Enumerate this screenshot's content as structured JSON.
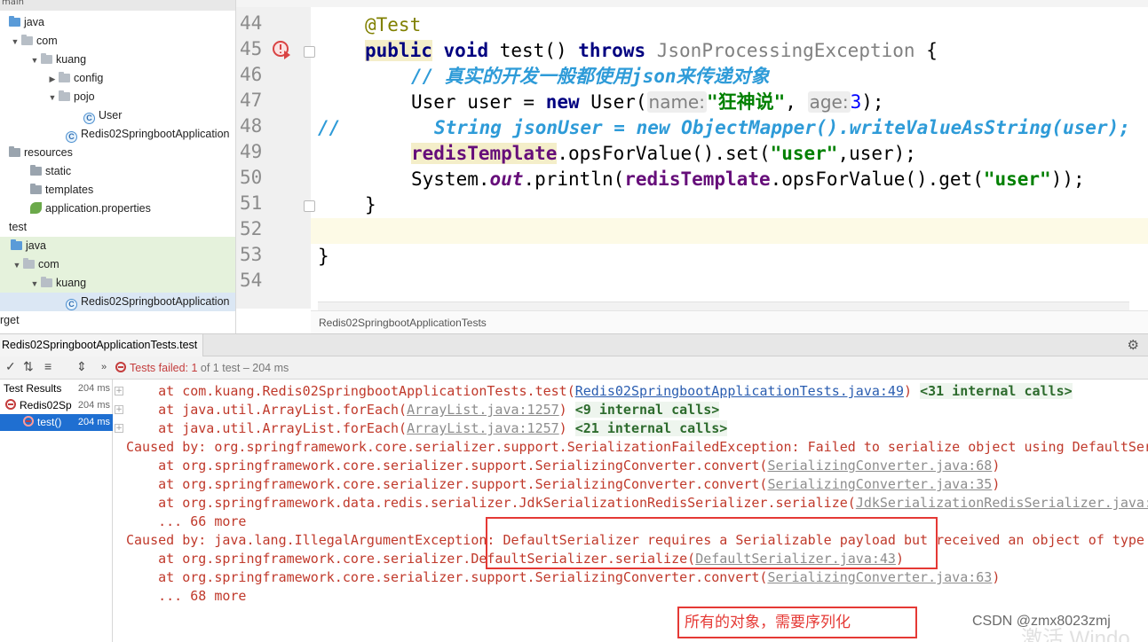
{
  "tree": {
    "top_label": "main",
    "items": [
      {
        "label": "java",
        "icon": "folder-blue-icon"
      },
      {
        "label": "com",
        "icon": "package-icon"
      },
      {
        "label": "kuang",
        "icon": "package-icon"
      },
      {
        "label": "config",
        "icon": "package-icon"
      },
      {
        "label": "pojo",
        "icon": "package-icon"
      },
      {
        "label": "User",
        "icon": "class-icon"
      },
      {
        "label": "Redis02SpringbootApplication",
        "icon": "class-icon"
      },
      {
        "label": "resources",
        "icon": "folder-icon"
      },
      {
        "label": "static",
        "icon": "folder-icon"
      },
      {
        "label": "templates",
        "icon": "folder-icon"
      },
      {
        "label": "application.properties",
        "icon": "properties-icon"
      },
      {
        "label": "test",
        "icon": ""
      },
      {
        "label": "java",
        "icon": "folder-blue-icon"
      },
      {
        "label": "com",
        "icon": "package-icon"
      },
      {
        "label": "kuang",
        "icon": "package-icon"
      },
      {
        "label": "Redis02SpringbootApplication",
        "icon": "class-icon"
      },
      {
        "label": "rget",
        "icon": ""
      }
    ]
  },
  "editor": {
    "line_numbers": [
      "44",
      "45",
      "46",
      "47",
      "48",
      "49",
      "50",
      "51",
      "52",
      "53",
      "54"
    ],
    "line44": "@Test",
    "line45": {
      "kw1": "public",
      "kw2": "void",
      "name": " test() ",
      "kw3": "throws",
      "exc": " JsonProcessingException",
      "tail": " {"
    },
    "line46": "// 真实的开发一般都使用json来传递对象",
    "line47": {
      "type": "User user = ",
      "kw": "new",
      "cls": " User(",
      "hint1": "name:",
      "str": "\"狂神说\"",
      "sep": ", ",
      "hint2": "age:",
      "num": "3",
      "tail": ");"
    },
    "line48": {
      "prefix": "//",
      "code": "String jsonUser = new ObjectMapper().writeValueAsString(user);"
    },
    "line49": {
      "field": "redisTemplate",
      "mid": ".opsForValue().set(",
      "str": "\"user\"",
      "tail": ",user);"
    },
    "line50": {
      "a": "System.",
      "b": "out",
      "c": ".println(",
      "d": "redisTemplate",
      "e": ".opsForValue().get(",
      "f": "\"user\"",
      "g": "));"
    },
    "line51": "}",
    "line53": "}",
    "breadcrumb": "Redis02SpringbootApplicationTests"
  },
  "run": {
    "tab": "Redis02SpringbootApplicationTests.test",
    "fail_label": "Tests failed: 1",
    "fail_detail": " of 1 test – 204 ms",
    "results": [
      {
        "label": "Test Results",
        "time": "204 ms"
      },
      {
        "label": "Redis02Sp",
        "time": "204 ms"
      },
      {
        "label": "test()",
        "time": "204 ms"
      }
    ]
  },
  "console": {
    "l1": {
      "pre": "    at com.kuang.Redis02SpringbootApplicationTests.test(",
      "link": "Redis02SpringbootApplicationTests.java:49",
      "post": ") ",
      "ic": "<31 internal calls>"
    },
    "l2": {
      "pre": "    at java.util.ArrayList.forEach(",
      "link": "ArrayList.java:1257",
      "post": ") ",
      "ic": "<9 internal calls>"
    },
    "l3": {
      "pre": "    at java.util.ArrayList.forEach(",
      "link": "ArrayList.java:1257",
      "post": ") ",
      "ic": "<21 internal calls>"
    },
    "l4": "Caused by: org.springframework.core.serializer.support.SerializationFailedException: Failed to serialize object using DefaultSer",
    "l5": {
      "pre": "    at org.springframework.core.serializer.support.SerializingConverter.convert(",
      "link": "SerializingConverter.java:68",
      "post": ")"
    },
    "l6": {
      "pre": "    at org.springframework.core.serializer.support.SerializingConverter.convert(",
      "link": "SerializingConverter.java:35",
      "post": ")"
    },
    "l7": {
      "pre": "    at org.springframework.data.redis.serializer.JdkSerializationRedisSerializer.serialize(",
      "link": "JdkSerializationRedisSerializer.java:",
      "post": ""
    },
    "l8": "    ... 66 more",
    "l9": "Caused by: java.lang.IllegalArgumentException: DefaultSerializer requires a Serializable payload but received an object of type",
    "l10": {
      "pre": "    at org.springframework.core.serializer.DefaultSerializer.serialize(",
      "link": "DefaultSerializer.java:43",
      "post": ")"
    },
    "l11": {
      "pre": "    at org.springframework.core.serializer.support.SerializingConverter.convert(",
      "link": "SerializingConverter.java:63",
      "post": ")"
    },
    "l12": "    ... 68 more"
  },
  "annotation": {
    "note": "所有的对象，需要序列化",
    "watermark": "CSDN @zmx8023zmj",
    "os_watermark": "激活 Windo"
  },
  "colors": {
    "error_red": "#c0392b",
    "annotation_red": "#e53935",
    "keyword": "#000080",
    "string": "#008000",
    "comment": "#2e9bd8",
    "selection": "#1f6fd1"
  }
}
